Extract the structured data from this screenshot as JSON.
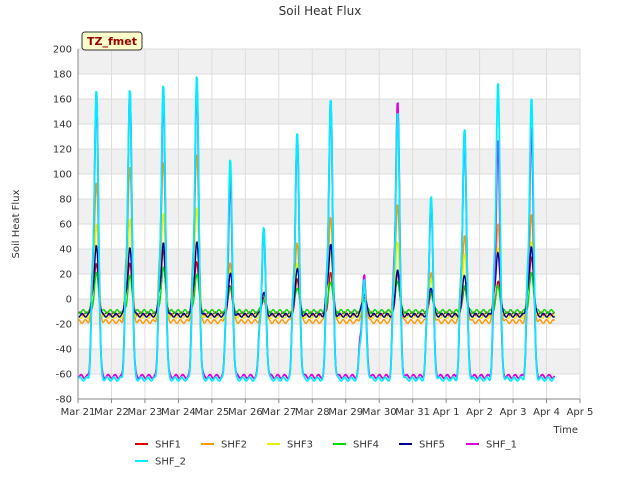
{
  "chart_data": {
    "type": "line",
    "title": "Soil Heat Flux",
    "xlabel": "Time",
    "ylabel": "Soil Heat Flux",
    "badge": "TZ_fmet",
    "ylim": [
      -80,
      200
    ],
    "yticks": [
      -80,
      -60,
      -40,
      -20,
      0,
      20,
      40,
      60,
      80,
      100,
      120,
      140,
      160,
      180,
      200
    ],
    "xlim": [
      0,
      15
    ],
    "xticks": [
      {
        "x": 0,
        "label": "Mar 21"
      },
      {
        "x": 1,
        "label": "Mar 22"
      },
      {
        "x": 2,
        "label": "Mar 23"
      },
      {
        "x": 3,
        "label": "Mar 24"
      },
      {
        "x": 4,
        "label": "Mar 25"
      },
      {
        "x": 5,
        "label": "Mar 26"
      },
      {
        "x": 6,
        "label": "Mar 27"
      },
      {
        "x": 7,
        "label": "Mar 28"
      },
      {
        "x": 8,
        "label": "Mar 29"
      },
      {
        "x": 9,
        "label": "Mar 30"
      },
      {
        "x": 10,
        "label": "Mar 31"
      },
      {
        "x": 11,
        "label": "Apr 1"
      },
      {
        "x": 12,
        "label": "Apr 2"
      },
      {
        "x": 13,
        "label": "Apr 3"
      },
      {
        "x": 14,
        "label": "Apr 4"
      },
      {
        "x": 15,
        "label": "Apr 5"
      }
    ],
    "grid": true,
    "legend_position": "bottom",
    "x_units": "days since Mar 21",
    "series": [
      {
        "name": "SHF1",
        "color": "#dd0000",
        "base": -12,
        "peaks": [
          30,
          30,
          40,
          30,
          10,
          0,
          15,
          20,
          0,
          20,
          5,
          10,
          15,
          35
        ]
      },
      {
        "name": "SHF2",
        "color": "#ff9900",
        "base": -18,
        "peaks": [
          95,
          108,
          112,
          118,
          30,
          5,
          45,
          65,
          15,
          75,
          20,
          50,
          60,
          68
        ]
      },
      {
        "name": "SHF3",
        "color": "#eeee00",
        "base": -14,
        "peaks": [
          60,
          65,
          70,
          75,
          25,
          5,
          30,
          40,
          10,
          45,
          15,
          35,
          40,
          45
        ]
      },
      {
        "name": "SHF4",
        "color": "#00dd00",
        "base": -10,
        "peaks": [
          20,
          18,
          25,
          20,
          10,
          0,
          10,
          15,
          0,
          15,
          5,
          10,
          10,
          20
        ]
      },
      {
        "name": "SHF5",
        "color": "#000099",
        "base": -13,
        "peaks": [
          42,
          40,
          44,
          45,
          20,
          5,
          25,
          45,
          5,
          25,
          10,
          20,
          38,
          42
        ]
      },
      {
        "name": "SHF_1",
        "color": "#dd00dd",
        "base": -62,
        "peaks": [
          165,
          168,
          165,
          172,
          95,
          55,
          130,
          158,
          20,
          160,
          80,
          135,
          130,
          140
        ]
      },
      {
        "name": "SHF_2",
        "color": "#00eeff",
        "base": -64,
        "peaks": [
          170,
          170,
          173,
          180,
          112,
          57,
          133,
          160,
          15,
          150,
          83,
          138,
          176,
          164
        ]
      }
    ]
  }
}
